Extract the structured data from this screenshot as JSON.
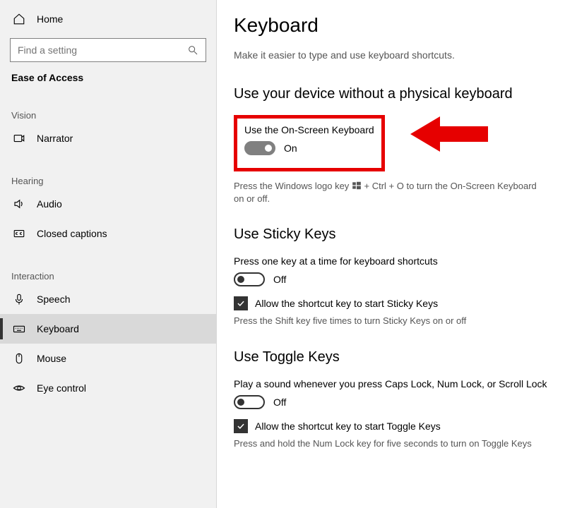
{
  "sidebar": {
    "home": "Home",
    "search_placeholder": "Find a setting",
    "heading": "Ease of Access",
    "groups": [
      {
        "label": "Vision",
        "items": [
          {
            "id": "narrator",
            "label": "Narrator"
          }
        ]
      },
      {
        "label": "Hearing",
        "items": [
          {
            "id": "audio",
            "label": "Audio"
          },
          {
            "id": "closed-captions",
            "label": "Closed captions"
          }
        ]
      },
      {
        "label": "Interaction",
        "items": [
          {
            "id": "speech",
            "label": "Speech"
          },
          {
            "id": "keyboard",
            "label": "Keyboard"
          },
          {
            "id": "mouse",
            "label": "Mouse"
          },
          {
            "id": "eye-control",
            "label": "Eye control"
          }
        ]
      }
    ]
  },
  "main": {
    "title": "Keyboard",
    "subtitle": "Make it easier to type and use keyboard shortcuts.",
    "osk": {
      "section_title": "Use your device without a physical keyboard",
      "label": "Use the On-Screen Keyboard",
      "state_text": "On",
      "hint_before": "Press the Windows logo key ",
      "hint_after": " + Ctrl + O to turn the On-Screen Keyboard on or off."
    },
    "sticky": {
      "section_title": "Use Sticky Keys",
      "label": "Press one key at a time for keyboard shortcuts",
      "state_text": "Off",
      "checkbox_label": "Allow the shortcut key to start Sticky Keys",
      "hint": "Press the Shift key five times to turn Sticky Keys on or off"
    },
    "toggle": {
      "section_title": "Use Toggle Keys",
      "label": "Play a sound whenever you press Caps Lock, Num Lock, or Scroll Lock",
      "state_text": "Off",
      "checkbox_label": "Allow the shortcut key to start Toggle Keys",
      "hint": "Press and hold the Num Lock key for five seconds to turn on Toggle Keys"
    }
  }
}
